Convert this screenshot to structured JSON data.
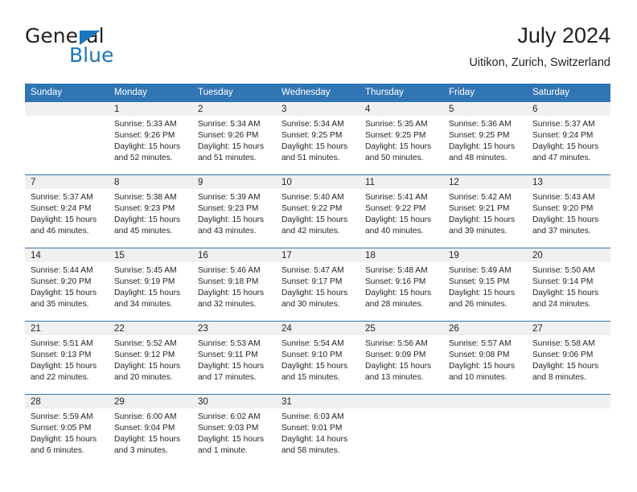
{
  "brand": {
    "name_part1": "General",
    "name_part2": "Blue",
    "triangle_color": "#1b75bb"
  },
  "header": {
    "title": "July 2024",
    "subtitle": "Uitikon, Zurich, Switzerland"
  },
  "theme": {
    "header_band": "#3275b4",
    "daynum_band": "#f0f0f0",
    "row_separator": "#3275b4",
    "text": "#231f20"
  },
  "weekday_headers": [
    "Sunday",
    "Monday",
    "Tuesday",
    "Wednesday",
    "Thursday",
    "Friday",
    "Saturday"
  ],
  "weeks": [
    [
      {
        "day": "",
        "sunrise": "",
        "sunset": "",
        "daylight1": "",
        "daylight2": ""
      },
      {
        "day": "1",
        "sunrise": "Sunrise: 5:33 AM",
        "sunset": "Sunset: 9:26 PM",
        "daylight1": "Daylight: 15 hours",
        "daylight2": "and 52 minutes."
      },
      {
        "day": "2",
        "sunrise": "Sunrise: 5:34 AM",
        "sunset": "Sunset: 9:26 PM",
        "daylight1": "Daylight: 15 hours",
        "daylight2": "and 51 minutes."
      },
      {
        "day": "3",
        "sunrise": "Sunrise: 5:34 AM",
        "sunset": "Sunset: 9:25 PM",
        "daylight1": "Daylight: 15 hours",
        "daylight2": "and 51 minutes."
      },
      {
        "day": "4",
        "sunrise": "Sunrise: 5:35 AM",
        "sunset": "Sunset: 9:25 PM",
        "daylight1": "Daylight: 15 hours",
        "daylight2": "and 50 minutes."
      },
      {
        "day": "5",
        "sunrise": "Sunrise: 5:36 AM",
        "sunset": "Sunset: 9:25 PM",
        "daylight1": "Daylight: 15 hours",
        "daylight2": "and 48 minutes."
      },
      {
        "day": "6",
        "sunrise": "Sunrise: 5:37 AM",
        "sunset": "Sunset: 9:24 PM",
        "daylight1": "Daylight: 15 hours",
        "daylight2": "and 47 minutes."
      }
    ],
    [
      {
        "day": "7",
        "sunrise": "Sunrise: 5:37 AM",
        "sunset": "Sunset: 9:24 PM",
        "daylight1": "Daylight: 15 hours",
        "daylight2": "and 46 minutes."
      },
      {
        "day": "8",
        "sunrise": "Sunrise: 5:38 AM",
        "sunset": "Sunset: 9:23 PM",
        "daylight1": "Daylight: 15 hours",
        "daylight2": "and 45 minutes."
      },
      {
        "day": "9",
        "sunrise": "Sunrise: 5:39 AM",
        "sunset": "Sunset: 9:23 PM",
        "daylight1": "Daylight: 15 hours",
        "daylight2": "and 43 minutes."
      },
      {
        "day": "10",
        "sunrise": "Sunrise: 5:40 AM",
        "sunset": "Sunset: 9:22 PM",
        "daylight1": "Daylight: 15 hours",
        "daylight2": "and 42 minutes."
      },
      {
        "day": "11",
        "sunrise": "Sunrise: 5:41 AM",
        "sunset": "Sunset: 9:22 PM",
        "daylight1": "Daylight: 15 hours",
        "daylight2": "and 40 minutes."
      },
      {
        "day": "12",
        "sunrise": "Sunrise: 5:42 AM",
        "sunset": "Sunset: 9:21 PM",
        "daylight1": "Daylight: 15 hours",
        "daylight2": "and 39 minutes."
      },
      {
        "day": "13",
        "sunrise": "Sunrise: 5:43 AM",
        "sunset": "Sunset: 9:20 PM",
        "daylight1": "Daylight: 15 hours",
        "daylight2": "and 37 minutes."
      }
    ],
    [
      {
        "day": "14",
        "sunrise": "Sunrise: 5:44 AM",
        "sunset": "Sunset: 9:20 PM",
        "daylight1": "Daylight: 15 hours",
        "daylight2": "and 35 minutes."
      },
      {
        "day": "15",
        "sunrise": "Sunrise: 5:45 AM",
        "sunset": "Sunset: 9:19 PM",
        "daylight1": "Daylight: 15 hours",
        "daylight2": "and 34 minutes."
      },
      {
        "day": "16",
        "sunrise": "Sunrise: 5:46 AM",
        "sunset": "Sunset: 9:18 PM",
        "daylight1": "Daylight: 15 hours",
        "daylight2": "and 32 minutes."
      },
      {
        "day": "17",
        "sunrise": "Sunrise: 5:47 AM",
        "sunset": "Sunset: 9:17 PM",
        "daylight1": "Daylight: 15 hours",
        "daylight2": "and 30 minutes."
      },
      {
        "day": "18",
        "sunrise": "Sunrise: 5:48 AM",
        "sunset": "Sunset: 9:16 PM",
        "daylight1": "Daylight: 15 hours",
        "daylight2": "and 28 minutes."
      },
      {
        "day": "19",
        "sunrise": "Sunrise: 5:49 AM",
        "sunset": "Sunset: 9:15 PM",
        "daylight1": "Daylight: 15 hours",
        "daylight2": "and 26 minutes."
      },
      {
        "day": "20",
        "sunrise": "Sunrise: 5:50 AM",
        "sunset": "Sunset: 9:14 PM",
        "daylight1": "Daylight: 15 hours",
        "daylight2": "and 24 minutes."
      }
    ],
    [
      {
        "day": "21",
        "sunrise": "Sunrise: 5:51 AM",
        "sunset": "Sunset: 9:13 PM",
        "daylight1": "Daylight: 15 hours",
        "daylight2": "and 22 minutes."
      },
      {
        "day": "22",
        "sunrise": "Sunrise: 5:52 AM",
        "sunset": "Sunset: 9:12 PM",
        "daylight1": "Daylight: 15 hours",
        "daylight2": "and 20 minutes."
      },
      {
        "day": "23",
        "sunrise": "Sunrise: 5:53 AM",
        "sunset": "Sunset: 9:11 PM",
        "daylight1": "Daylight: 15 hours",
        "daylight2": "and 17 minutes."
      },
      {
        "day": "24",
        "sunrise": "Sunrise: 5:54 AM",
        "sunset": "Sunset: 9:10 PM",
        "daylight1": "Daylight: 15 hours",
        "daylight2": "and 15 minutes."
      },
      {
        "day": "25",
        "sunrise": "Sunrise: 5:56 AM",
        "sunset": "Sunset: 9:09 PM",
        "daylight1": "Daylight: 15 hours",
        "daylight2": "and 13 minutes."
      },
      {
        "day": "26",
        "sunrise": "Sunrise: 5:57 AM",
        "sunset": "Sunset: 9:08 PM",
        "daylight1": "Daylight: 15 hours",
        "daylight2": "and 10 minutes."
      },
      {
        "day": "27",
        "sunrise": "Sunrise: 5:58 AM",
        "sunset": "Sunset: 9:06 PM",
        "daylight1": "Daylight: 15 hours",
        "daylight2": "and 8 minutes."
      }
    ],
    [
      {
        "day": "28",
        "sunrise": "Sunrise: 5:59 AM",
        "sunset": "Sunset: 9:05 PM",
        "daylight1": "Daylight: 15 hours",
        "daylight2": "and 6 minutes."
      },
      {
        "day": "29",
        "sunrise": "Sunrise: 6:00 AM",
        "sunset": "Sunset: 9:04 PM",
        "daylight1": "Daylight: 15 hours",
        "daylight2": "and 3 minutes."
      },
      {
        "day": "30",
        "sunrise": "Sunrise: 6:02 AM",
        "sunset": "Sunset: 9:03 PM",
        "daylight1": "Daylight: 15 hours",
        "daylight2": "and 1 minute."
      },
      {
        "day": "31",
        "sunrise": "Sunrise: 6:03 AM",
        "sunset": "Sunset: 9:01 PM",
        "daylight1": "Daylight: 14 hours",
        "daylight2": "and 58 minutes."
      },
      {
        "day": "",
        "sunrise": "",
        "sunset": "",
        "daylight1": "",
        "daylight2": ""
      },
      {
        "day": "",
        "sunrise": "",
        "sunset": "",
        "daylight1": "",
        "daylight2": ""
      },
      {
        "day": "",
        "sunrise": "",
        "sunset": "",
        "daylight1": "",
        "daylight2": ""
      }
    ]
  ]
}
